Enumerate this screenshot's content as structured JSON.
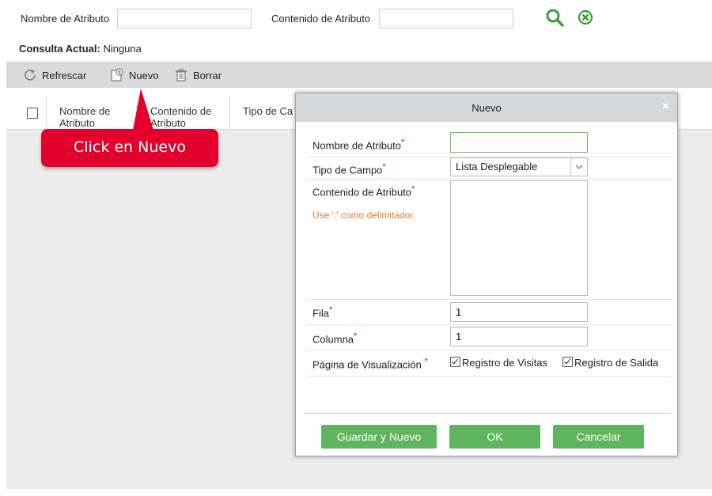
{
  "filters": {
    "attribute_name_label": "Nombre de Atributo",
    "attribute_name_value": "",
    "attribute_content_label": "Contenido de Atributo",
    "attribute_content_value": ""
  },
  "query": {
    "label": "Consulta Actual:",
    "value": "Ninguna"
  },
  "toolbar": {
    "refresh_label": "Refrescar",
    "new_label": "Nuevo",
    "delete_label": "Borrar"
  },
  "table": {
    "columns": [
      {
        "line1": "Nombre de",
        "line2": "Atributo"
      },
      {
        "line1": "Contenido de",
        "line2": "Atributo"
      },
      {
        "line1": "Tipo de Ca",
        "line2": ""
      }
    ]
  },
  "callout": {
    "text": "Click en Nuevo"
  },
  "dialog": {
    "title": "Nuevo",
    "close_glyph": "×",
    "name_label": "Nombre de Atributo",
    "field_type_label": "Tipo de Campo",
    "field_type_value": "Lista Desplegable",
    "content_label": "Contenido de Atributo",
    "content_hint": "Use ';' como delimitador.",
    "row_label": "Fila",
    "row_value": "1",
    "column_label": "Columna",
    "column_value": "1",
    "display_page_label": "Página de Visualización",
    "display_options": [
      "Registro de Visitas",
      "Registro de Salida"
    ],
    "required_mark": "*",
    "buttons": {
      "save_new": "Guardar y Nuevo",
      "ok": "OK",
      "cancel": "Cancelar"
    }
  },
  "colors": {
    "accent_green": "#5fb55e",
    "icon_green": "#3c9a3a",
    "callout_red": "#e3002c",
    "hint_orange": "#e07a2a",
    "required_red": "#e00000"
  },
  "icons": {
    "search": "search-icon",
    "clear": "clear-icon",
    "refresh": "refresh-icon",
    "new": "new-icon",
    "delete": "trash-icon"
  }
}
